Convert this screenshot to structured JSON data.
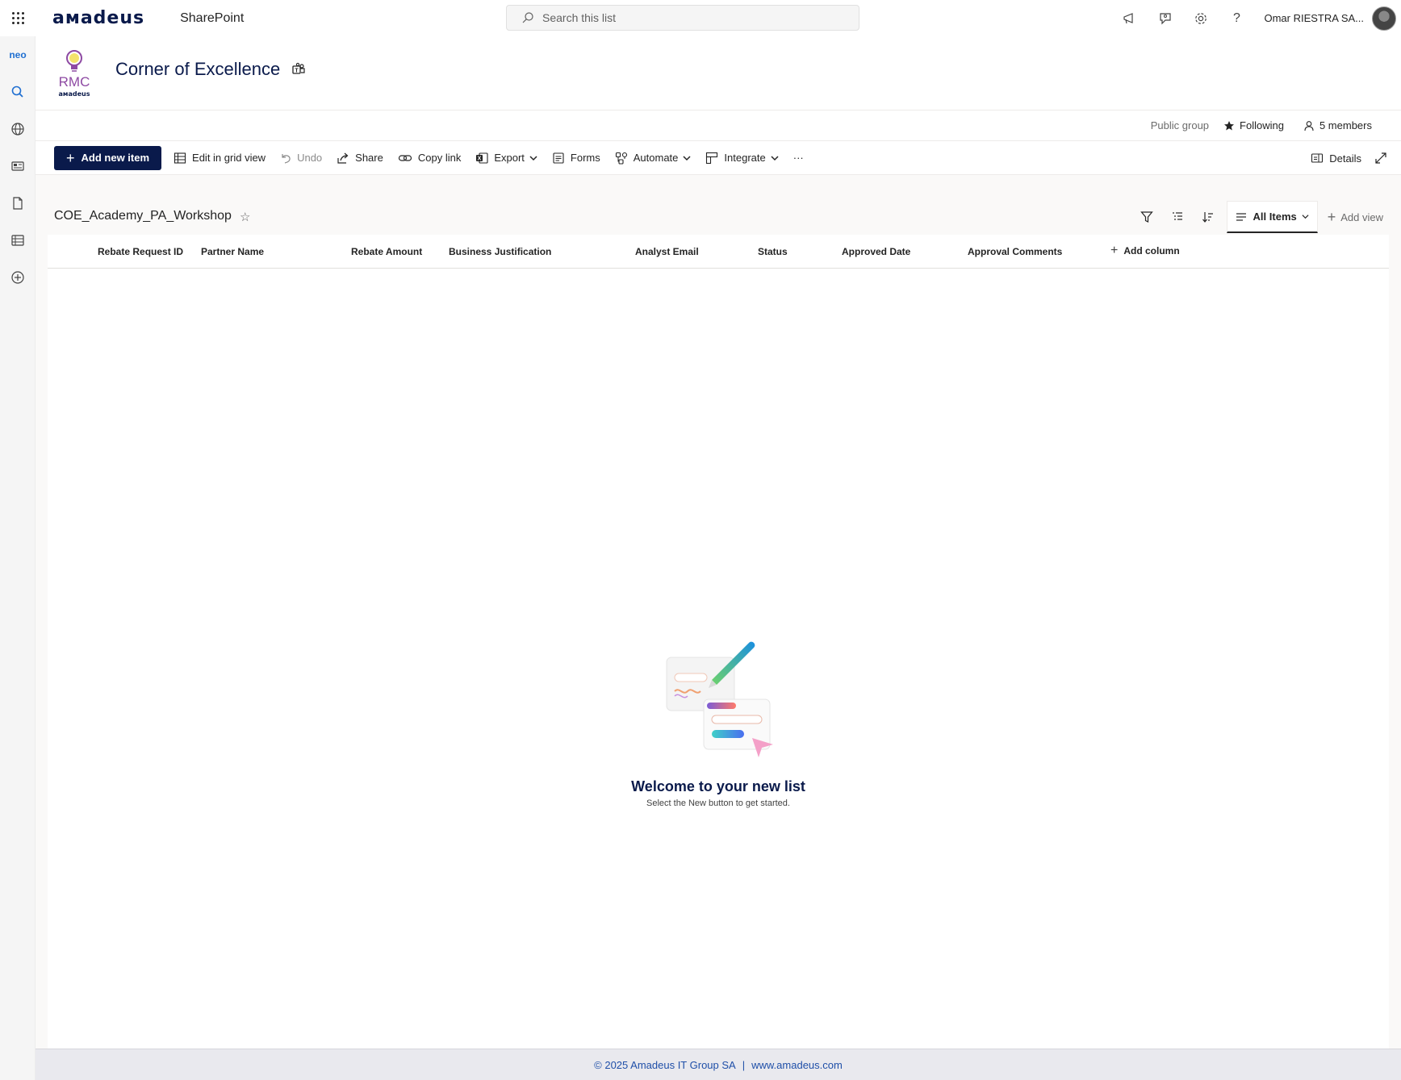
{
  "suite": {
    "brand": "aмadeus",
    "app_name": "SharePoint",
    "search_placeholder": "Search this list",
    "user_name": "Omar RIESTRA SA..."
  },
  "left_rail": {
    "neo_label": "neo"
  },
  "site": {
    "title": "Corner of Excellence",
    "logo_text": "RMC",
    "logo_subtext": "aмadeus",
    "privacy": "Public group",
    "following": "Following",
    "members": "5 members"
  },
  "command_bar": {
    "add_new_item": "Add new item",
    "edit_grid": "Edit in grid view",
    "undo": "Undo",
    "share": "Share",
    "copy_link": "Copy link",
    "export": "Export",
    "forms": "Forms",
    "automate": "Automate",
    "integrate": "Integrate",
    "more": "···",
    "details": "Details"
  },
  "list": {
    "title": "COE_Academy_PA_Workshop",
    "view_name": "All Items",
    "add_view": "Add view",
    "columns": [
      "Rebate Request ID",
      "Partner Name",
      "Rebate Amount",
      "Business Justification",
      "Analyst Email",
      "Status",
      "Approved Date",
      "Approval Comments"
    ],
    "add_column": "Add column",
    "empty_title": "Welcome to your new list",
    "empty_subtitle": "Select the New button to get started."
  },
  "footer": {
    "copyright": "© 2025 Amadeus IT Group SA",
    "separator": "|",
    "website": "www.amadeus.com"
  },
  "colors": {
    "brand_navy": "#0a1a4b",
    "link_blue": "#1f4fa8",
    "neo_blue": "#1f6fd1",
    "logo_purple": "#8e4aa3"
  }
}
